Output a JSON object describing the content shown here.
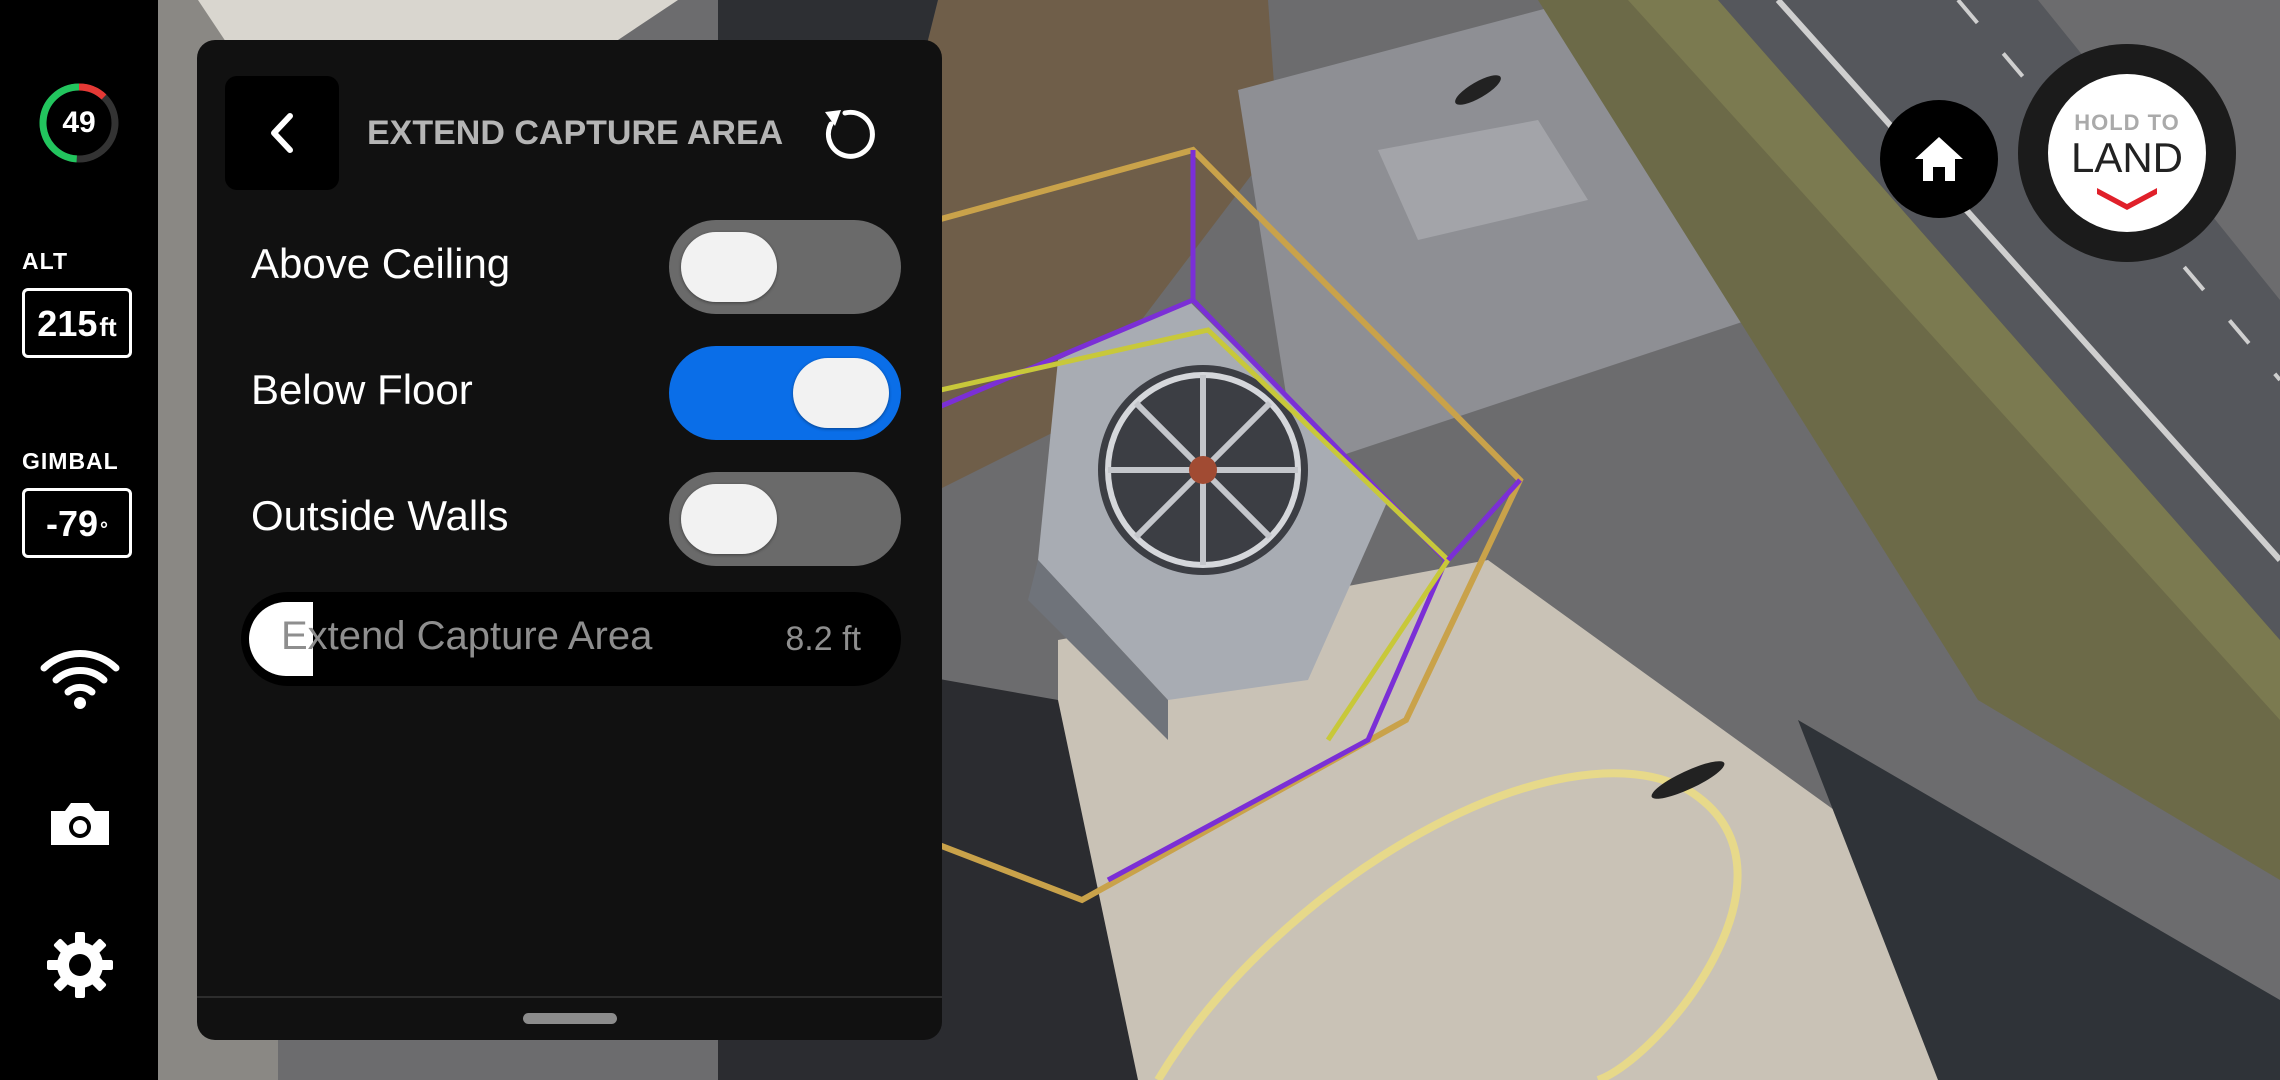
{
  "rail": {
    "battery_percent": "49",
    "battery_level": 0.49,
    "alt_label": "ALT",
    "alt_value": "215",
    "alt_unit": "ft",
    "gimbal_label": "GIMBAL",
    "gimbal_value": "-79",
    "gimbal_unit": "°",
    "icons": [
      "wifi-icon",
      "camera-icon",
      "gear-icon"
    ]
  },
  "panel": {
    "title": "EXTEND CAPTURE AREA",
    "toggles": [
      {
        "label": "Above Ceiling",
        "on": false
      },
      {
        "label": "Below Floor",
        "on": true
      },
      {
        "label": "Outside Walls",
        "on": false
      }
    ],
    "slider": {
      "label": "Extend Capture Area",
      "value": "8.2 ft",
      "fill_fraction": 0.1
    }
  },
  "controls": {
    "land_top": "HOLD TO",
    "land_main": "LAND"
  },
  "colors": {
    "accent_blue": "#0a6ee8",
    "land_red": "#e0202a",
    "battery_green": "#22c55e",
    "battery_red": "#e53935",
    "capture_purple": "#7b2fd6",
    "capture_gold": "#c9a24a",
    "capture_yellow": "#c8c83a"
  }
}
